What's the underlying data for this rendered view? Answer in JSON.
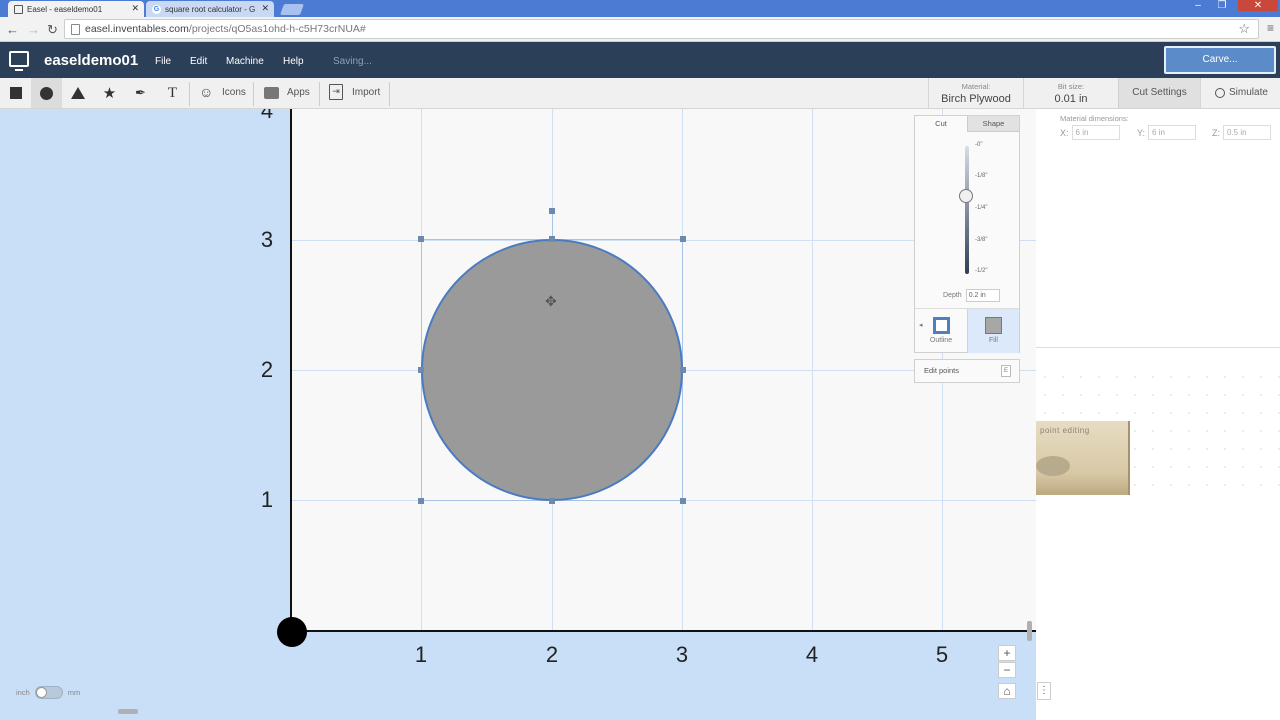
{
  "browser": {
    "tabs": [
      {
        "title": "Easel - easeldemo01"
      },
      {
        "title": "square root calculator - G"
      }
    ],
    "url_host": "easel.inventables.com",
    "url_path": "/projects/qO5as1ohd-h-c5H73crNUA#"
  },
  "app": {
    "project_name": "easeldemo01",
    "menu": [
      "File",
      "Edit",
      "Machine",
      "Help"
    ],
    "status": "Saving...",
    "carve_label": "Carve..."
  },
  "toolbar": {
    "icons_label": "Icons",
    "apps_label": "Apps",
    "import_label": "Import",
    "material_key": "Material:",
    "material_value": "Birch Plywood",
    "bit_key": "Bit size:",
    "bit_value": "0.01 in",
    "cut_settings_label": "Cut Settings",
    "simulate_label": "Simulate"
  },
  "canvas": {
    "y_ticks": [
      "4",
      "3",
      "2",
      "1"
    ],
    "x_ticks": [
      "1",
      "2",
      "3",
      "4",
      "5"
    ],
    "zoom_in": "+",
    "zoom_out": "−",
    "unit_left": "inch",
    "unit_right": "mm"
  },
  "cut_panel": {
    "tab_cut": "Cut",
    "tab_shape": "Shape",
    "depth_marks": [
      "-0\"",
      "-1/8\"",
      "-1/4\"",
      "-3/8\"",
      "-1/2\""
    ],
    "depth_label": "Depth",
    "depth_value": "0.2 in",
    "outline_label": "Outline",
    "fill_label": "Fill",
    "edit_points_label": "Edit points",
    "edit_points_key": "E"
  },
  "material_panel": {
    "title": "Material dimensions:",
    "x_label": "X:",
    "x_value": "6 in",
    "y_label": "Y:",
    "y_value": "6 in",
    "z_label": "Z:",
    "z_value": "0.5 in",
    "preview_text": "point editing"
  },
  "colors": {
    "header": "#2b3f58",
    "accent": "#5b8cc9",
    "canvas_bg": "#c8dff7",
    "shape_fill": "#9a9a9a"
  }
}
